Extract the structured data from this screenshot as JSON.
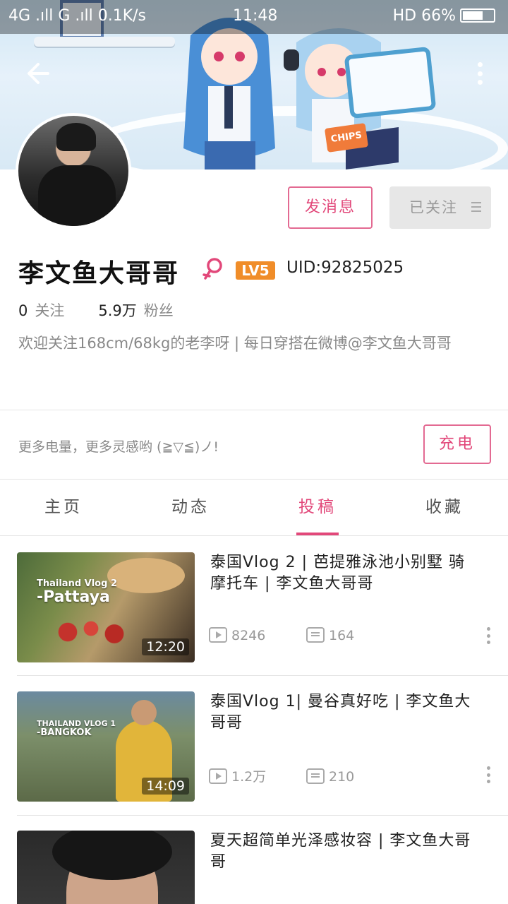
{
  "status_bar": {
    "left": "4G .ıll G .ıll 0.1K/s",
    "time": "11:48",
    "right": "HD 66%"
  },
  "banner": {
    "chips_text": "CHIPS"
  },
  "profile": {
    "send_message_label": "发消息",
    "followed_label": "已关注",
    "name": "李文鱼大哥哥",
    "level": "LV5",
    "uid": "UID:92825025",
    "following_count": "0",
    "following_label": "关注",
    "fans_count": "5.9万",
    "fans_label": "粉丝",
    "bio": "欢迎关注168cm/68kg的老李呀 | 每日穿搭在微博@李文鱼大哥哥"
  },
  "charge": {
    "text": "更多电量，更多灵感哟 (≧▽≦)ノ!",
    "button_label": "充电"
  },
  "tabs": [
    {
      "label": "主页",
      "active": false
    },
    {
      "label": "动态",
      "active": false
    },
    {
      "label": "投稿",
      "active": true
    },
    {
      "label": "收藏",
      "active": false
    }
  ],
  "videos": [
    {
      "title": "泰国Vlog 2 | 芭提雅泳池小别墅 骑摩托车 | 李文鱼大哥哥",
      "thumb_line1": "Thailand Vlog 2",
      "thumb_line2": "-Pattaya",
      "duration": "12:20",
      "views": "8246",
      "danmaku": "164"
    },
    {
      "title": "泰国Vlog 1| 曼谷真好吃 | 李文鱼大哥哥",
      "thumb_line1": "THAILAND VLOG 1",
      "thumb_line2": "-BANGKOK",
      "duration": "14:09",
      "views": "1.2万",
      "danmaku": "210"
    },
    {
      "title": "夏天超简单光泽感妆容 | 李文鱼大哥哥"
    }
  ]
}
